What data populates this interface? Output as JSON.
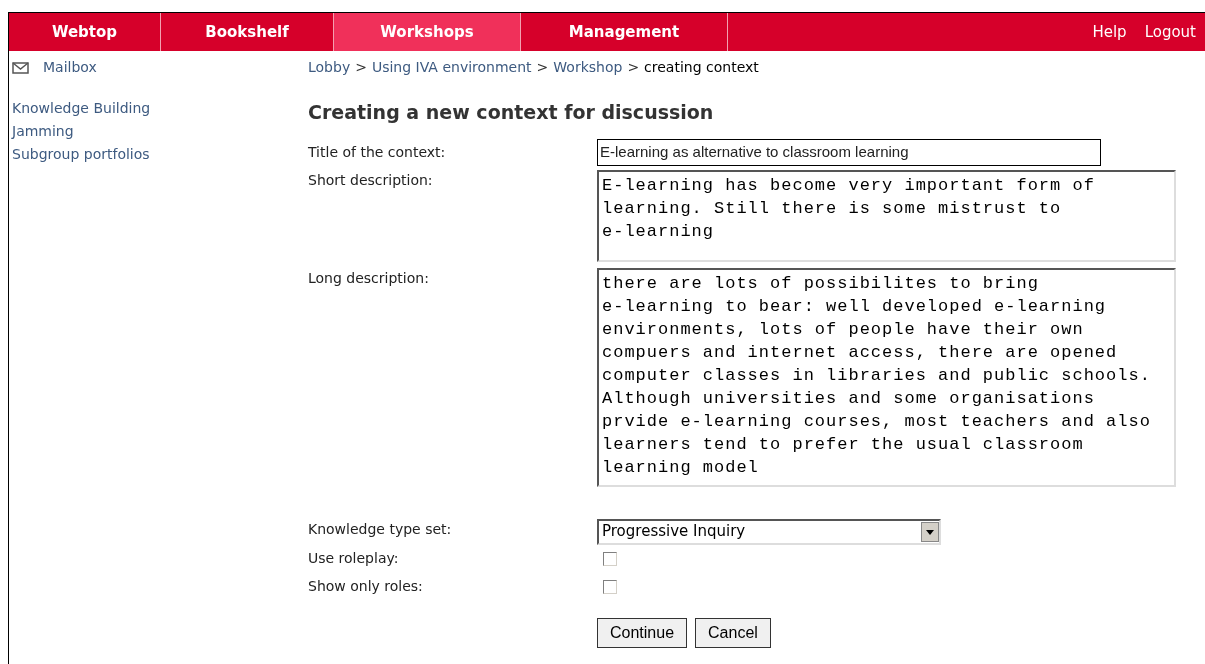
{
  "nav": {
    "tabs": [
      {
        "label": "Webtop",
        "selected": false
      },
      {
        "label": "Bookshelf",
        "selected": false
      },
      {
        "label": "Workshops",
        "selected": true
      },
      {
        "label": "Management",
        "selected": false
      }
    ],
    "links": [
      "Help",
      "Logout"
    ]
  },
  "sidebar": {
    "mailbox": "Mailbox",
    "items": [
      "Knowledge Building",
      "Jamming",
      "Subgroup portfolios"
    ]
  },
  "breadcrumb": [
    "Lobby",
    "Using IVA environment",
    "Workshop",
    "creating context"
  ],
  "breadcrumb_separator": ">",
  "heading": "Creating a new context for discussion",
  "form": {
    "title_label": "Title of the context:",
    "title_value": "E-learning as alternative to classroom learning",
    "short_label": "Short description:",
    "short_lines": [
      "E-learning has become very important form of",
      "learning. Still there is some mistrust to",
      "e-learning"
    ],
    "long_label": "Long description:",
    "long_lines": [
      "there are lots of possibilites to bring",
      "e-learning to bear: well developed e-learning",
      "environments, lots of people have their own",
      "compuers and internet access, there are opened",
      "computer classes in libraries and public schools.",
      "Although universities and some organisations",
      "prvide e-learning courses, most teachers and also",
      "learners tend to prefer the usual classroom",
      "learning model"
    ],
    "type_label": "Knowledge type set:",
    "type_value": "Progressive Inquiry",
    "checkboxes": [
      {
        "label": "Use roleplay:",
        "checked": false
      },
      {
        "label": "Show only roles:",
        "checked": false
      }
    ],
    "buttons": [
      "Continue",
      "Cancel"
    ]
  }
}
